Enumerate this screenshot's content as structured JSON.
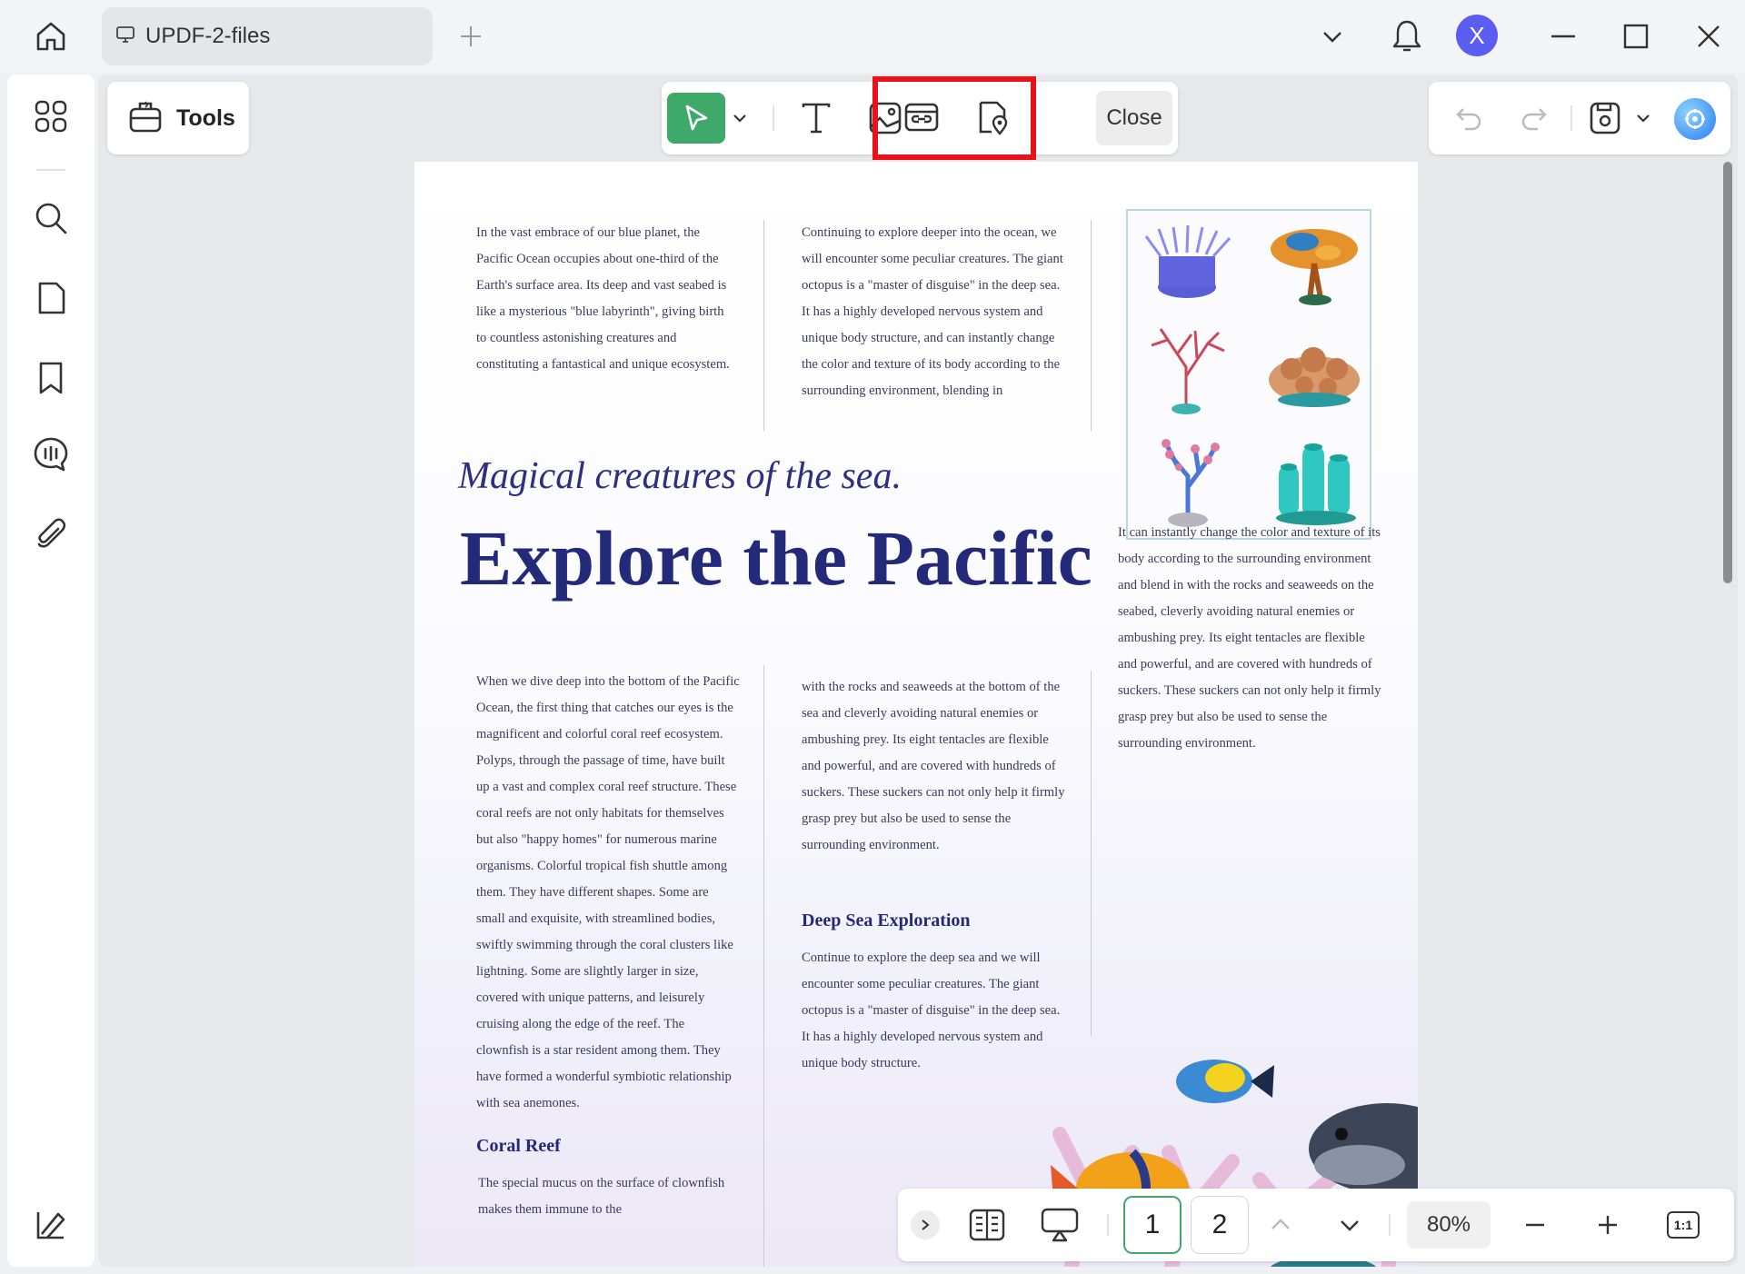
{
  "window": {
    "tab_title": "UPDF-2-files",
    "avatar_letter": "X"
  },
  "toolbar": {
    "tools_label": "Tools",
    "close_label": "Close"
  },
  "document": {
    "col1_top": "In the vast embrace of our blue planet, the Pacific Ocean occupies about one-third of the Earth's surface area. Its deep and vast seabed is like a mysterious \"blue labyrinth\", giving birth to countless astonishing creatures and constituting a fantastical and unique ecosystem.",
    "col2_top": "Continuing to explore deeper into the ocean, we will encounter some peculiar creatures. The giant octopus is a \"master of disguise\" in the deep sea. It has a highly developed nervous system and unique body structure, and can instantly change the color and texture of its body according to the surrounding environment, blending in",
    "subtitle": "Magical creatures of the sea.",
    "title": "Explore the Pacific",
    "col3_mid": "It can instantly change the color and texture of its body according to the surrounding environment and blend in with the rocks and seaweeds on the seabed, cleverly avoiding natural enemies or ambushing prey. Its eight tentacles are flexible and powerful, and are covered with hundreds of suckers. These suckers can not only help it firmly grasp prey but also be used to sense the surrounding environment.",
    "col1_bottom": "When we dive deep into the bottom of the Pacific Ocean, the first thing that catches our eyes is the magnificent and colorful coral reef ecosystem. Polyps, through the passage of time, have built up a vast and complex coral reef structure. These coral reefs are not only habitats for themselves but also \"happy homes\" for numerous marine organisms. Colorful tropical fish shuttle among them. They have different shapes. Some are small and exquisite, with streamlined bodies, swiftly swimming through the coral clusters like lightning. Some are slightly larger in size, covered with unique patterns, and leisurely cruising along the edge of the reef. The clownfish is a star resident among them. They have formed a wonderful symbiotic relationship with sea anemones.",
    "col2_bottom": "with the rocks and seaweeds at the bottom of the sea and cleverly avoiding natural enemies or ambushing prey. Its eight tentacles are flexible and powerful, and are covered with hundreds of suckers. These suckers can not only help it firmly grasp prey but also be used to sense the surrounding environment.",
    "heading_deep_sea": "Deep Sea Exploration",
    "deep_sea_text": "Continue to explore the deep sea and we will encounter some peculiar creatures. The giant octopus is a \"master of disguise\" in the deep sea. It has a highly developed nervous system and unique body structure.",
    "heading_coral": "Coral Reef",
    "coral_text": "The special mucus on the surface of clownfish makes them immune to the"
  },
  "bottombar": {
    "page1": "1",
    "page2": "2",
    "zoom": "80%",
    "fit_label": "1:1"
  },
  "colors": {
    "accent_green": "#3fa96a",
    "highlight_red": "#e8121b",
    "title_navy": "#242a7a",
    "avatar_purple": "#5b5cf0"
  }
}
